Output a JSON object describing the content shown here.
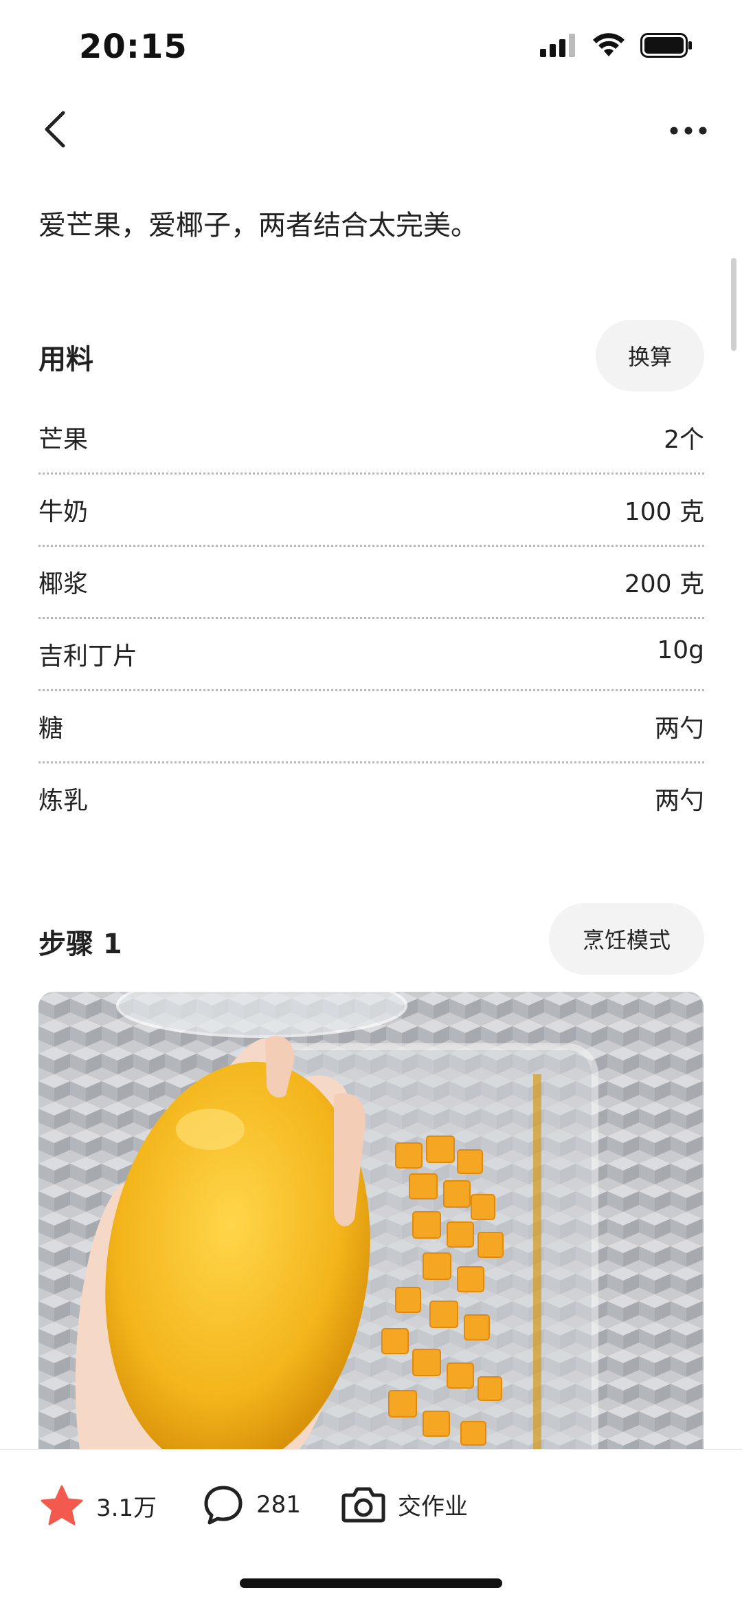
{
  "status_bar": {
    "time": "20:15"
  },
  "recipe": {
    "intro": "爱芒果，爱椰子，两者结合太完美。"
  },
  "ingredients_section": {
    "title": "用料",
    "convert_button": "换算",
    "items": [
      {
        "name": "芒果",
        "quantity": "2个"
      },
      {
        "name": "牛奶",
        "quantity": "100 克"
      },
      {
        "name": "椰浆",
        "quantity": "200 克"
      },
      {
        "name": "吉利丁片",
        "quantity": "10g"
      },
      {
        "name": "糖",
        "quantity": "两勺"
      },
      {
        "name": "炼乳",
        "quantity": "两勺"
      }
    ]
  },
  "step": {
    "title": "步骤 1",
    "cooking_mode_button": "烹饪模式"
  },
  "bottom_bar": {
    "favorites_count": "3.1万",
    "comments_count": "281",
    "submit_homework_label": "交作业"
  },
  "colors": {
    "star_accent": "#f25a4e",
    "pill_bg": "#f3f3f3",
    "text": "#222222"
  },
  "icons": {
    "back": "chevron-left-icon",
    "more": "more-horizontal-icon",
    "favorite": "star-icon",
    "comment": "comment-bubble-icon",
    "camera": "camera-icon"
  }
}
